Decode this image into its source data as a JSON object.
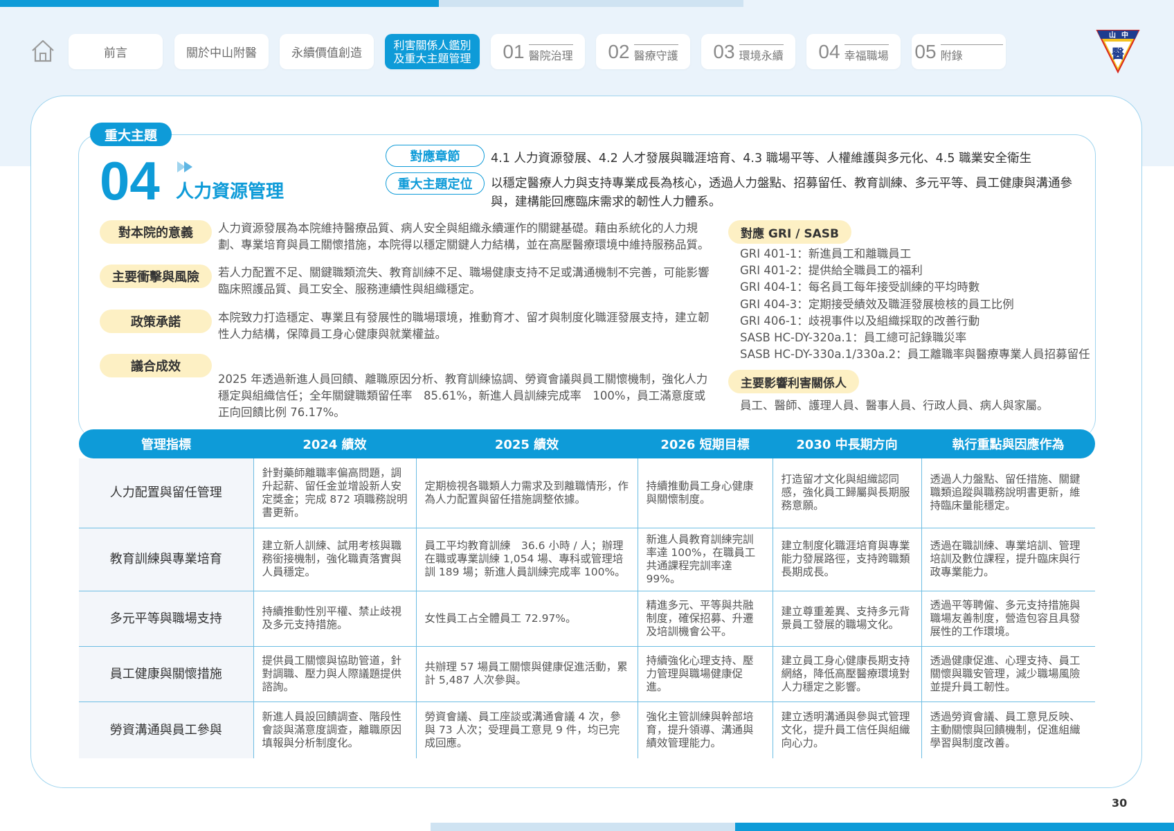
{
  "nav": {
    "tabs": [
      {
        "label": "前言"
      },
      {
        "label": "關於中山附醫"
      },
      {
        "label": "永續價值創造"
      },
      {
        "label_line1": "利害關係人鑑別",
        "label_line2": "及重大主題管理"
      },
      {
        "num": "01",
        "label": "醫院治理"
      },
      {
        "num": "02",
        "label": "醫療守護"
      },
      {
        "num": "03",
        "label": "環境永續"
      },
      {
        "num": "04",
        "label": "幸福職場"
      },
      {
        "num": "05",
        "label": "附錄"
      }
    ],
    "logo_text": "山中醫",
    "colors": {
      "accent": "#0e9bd8",
      "pill": "#fdf0c4"
    }
  },
  "theme": {
    "badge": "重大主題",
    "number": "04",
    "title": "人力資源管理",
    "chapter_label": "對應章節",
    "chapter_text": "4.1 人力資源發展、4.2 人才發展與職涯培育、4.3 職場平等、人權維護與多元化、4.5 職業安全衛生",
    "position_label": "重大主題定位",
    "position_text": "以穩定醫療人力與支持專業成長為核心，透過人力盤點、招募留任、教育訓練、多元平等、員工健康與溝通參與，建構能回應臨床需求的韌性人力體系。"
  },
  "sections": [
    {
      "label": "對本院的意義",
      "text": "人力資源發展為本院維持醫療品質、病人安全與組織永續運作的關鍵基礎。藉由系統化的人力規劃、專業培育與員工關懷措施，本院得以穩定關鍵人力結構，並在高壓醫療環境中維持服務品質。"
    },
    {
      "label": "主要衝擊與風險",
      "text": "若人力配置不足、關鍵職類流失、教育訓練不足、職場健康支持不足或溝通機制不完善，可能影響臨床照護品質、員工安全、服務連續性與組織穩定。"
    },
    {
      "label": "政策承諾",
      "text": "本院致力打造穩定、專業且有發展性的職場環境，推動育才、留才與制度化職涯發展支持，建立韌性人力結構，保障員工身心健康與就業權益。"
    },
    {
      "label": "議合成效",
      "text": "2025 年透過新進人員回饋、離職原因分析、教育訓練協調、勞資會議與員工關懷機制，強化人力穩定與組織信任；全年關鍵職類留任率　85.61%，新進人員訓練完成率　100%，員工滿意度或正向回饋比例 76.17%。"
    }
  ],
  "gri": {
    "label": "對應 GRI / SASB",
    "items": [
      "GRI 401-1：新進員工和離職員工",
      "GRI 401-2：提供給全職員工的福利",
      "GRI 404-1：每名員工每年接受訓練的平均時數",
      "GRI 404-3：定期接受績效及職涯發展檢核的員工比例",
      "GRI 406-1：歧視事件以及組織採取的改善行動",
      "SASB HC-DY-320a.1：員工總可記錄職災率",
      "SASB HC-DY-330a.1/330a.2：員工離職率與醫療專業人員招募留任"
    ]
  },
  "stakeholders": {
    "label": "主要影響利害關係人",
    "text": "員工、醫師、護理人員、醫事人員、行政人員、病人與家屬。"
  },
  "table": {
    "headers": [
      "管理指標",
      "2024 績效",
      "2025 績效",
      "2026 短期目標",
      "2030 中長期方向",
      "執行重點與因應作為"
    ],
    "rows": [
      [
        "人力配置與留任管理",
        "針對藥師離職率偏高問題，調升起薪、留任金並增設新人安定獎金；完成 872 項職務說明書更新。",
        "定期檢視各職類人力需求及到離職情形，作為人力配置與留任措施調整依據。",
        "持續推動員工身心健康與關懷制度。",
        "打造留才文化與組織認同感，強化員工歸屬與長期服務意願。",
        "透過人力盤點、留任措施、關鍵職類追蹤與職務說明書更新，維持臨床量能穩定。"
      ],
      [
        "教育訓練與專業培育",
        "建立新人訓練、試用考核與職務銜接機制，強化職責落實與人員穩定。",
        "員工平均教育訓練　36.6 小時 / 人；辦理在職或專業訓練 1,054 場、專科或管理培訓 189 場；新進人員訓練完成率 100%。",
        "新進人員教育訓練完訓率達 100%，在職員工共通課程完訓率達 99%。",
        "建立制度化職涯培育與專業能力發展路徑，支持跨職類長期成長。",
        "透過在職訓練、專業培訓、管理培訓及數位課程，提升臨床與行政專業能力。"
      ],
      [
        "多元平等與職場支持",
        "持續推動性別平權、禁止歧視及多元支持措施。",
        "女性員工占全體員工 72.97%。",
        "精進多元、平等與共融制度，確保招募、升遷及培訓機會公平。",
        "建立尊重差異、支持多元背景員工發展的職場文化。",
        "透過平等聘僱、多元支持措施與職場友善制度，營造包容且具發展性的工作環境。"
      ],
      [
        "員工健康與關懷措施",
        "提供員工關懷與協助管道，針對調職、壓力與人際議題提供諮詢。",
        "共辦理 57 場員工關懷與健康促進活動，累計 5,487 人次參與。",
        "持續強化心理支持、壓力管理與職場健康促進。",
        "建立員工身心健康長期支持網絡，降低高壓醫療環境對人力穩定之影響。",
        "透過健康促進、心理支持、員工關懷與職安管理，減少職場風險並提升員工韌性。"
      ],
      [
        "勞資溝通與員工參與",
        "新進人員設回饋調查、階段性會談與滿意度調查，離職原因填報與分析制度化。",
        "勞資會議、員工座談或溝通會議 4 次，參與 73 人次；受理員工意見 9 件，均已完成回應。",
        "強化主管訓練與幹部培育，提升領導、溝通與績效管理能力。",
        "建立透明溝通與參與式管理文化，提升員工信任與組織向心力。",
        "透過勞資會議、員工意見反映、主動關懷與回饋機制，促進組織學習與制度改善。"
      ]
    ]
  },
  "page_number": "30"
}
